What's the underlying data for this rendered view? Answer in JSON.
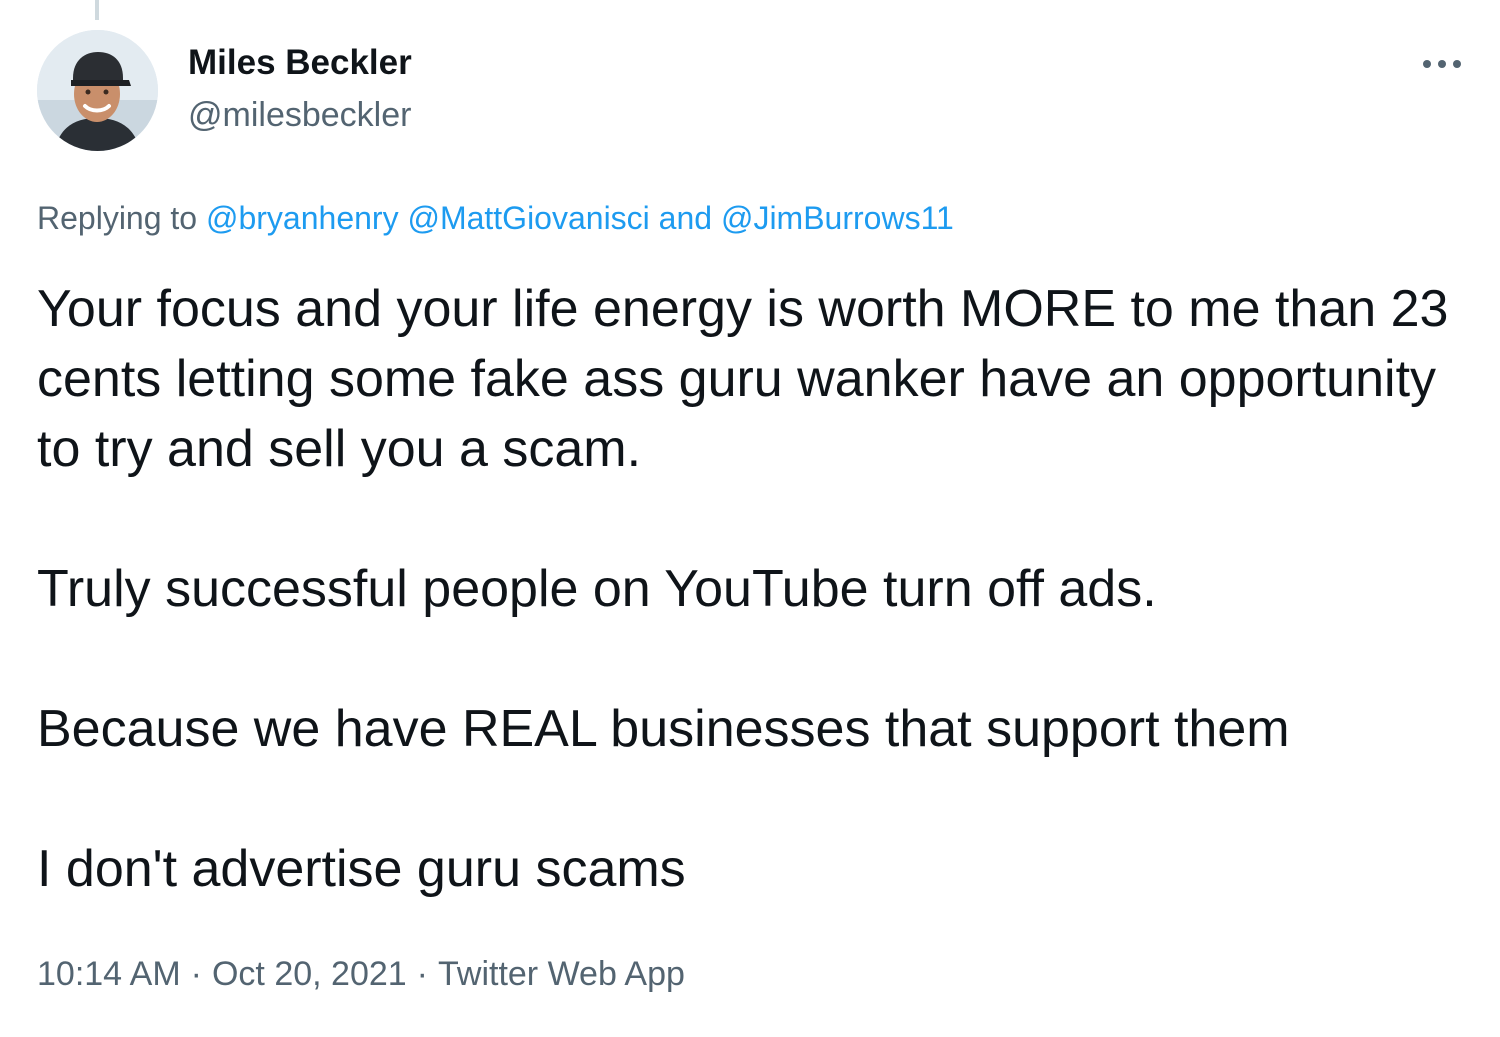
{
  "author": {
    "display_name": "Miles Beckler",
    "handle": "@milesbeckler",
    "avatar_icon": "profile-photo-icon"
  },
  "more_icon": "more-options-icon",
  "reply_context": {
    "prefix": "Replying to ",
    "mentions": [
      "@bryanhenry",
      "@MattGiovanisci",
      "@JimBurrows11"
    ],
    "separator": " ",
    "conjunction": " and "
  },
  "tweet": {
    "paragraphs": [
      "Your focus and your life energy is worth MORE to me than 23 cents letting some fake ass guru wanker have an opportunity to try and sell you a scam.",
      "Truly successful people on YouTube turn off ads.",
      "Because we have REAL businesses that support them",
      "I don't advertise guru scams"
    ]
  },
  "meta": {
    "time": "10:14 AM",
    "date": "Oct 20, 2021",
    "source": "Twitter Web App",
    "dot": "·"
  },
  "colors": {
    "text": "#0f1419",
    "secondary": "#536471",
    "link": "#1d9bf0"
  }
}
